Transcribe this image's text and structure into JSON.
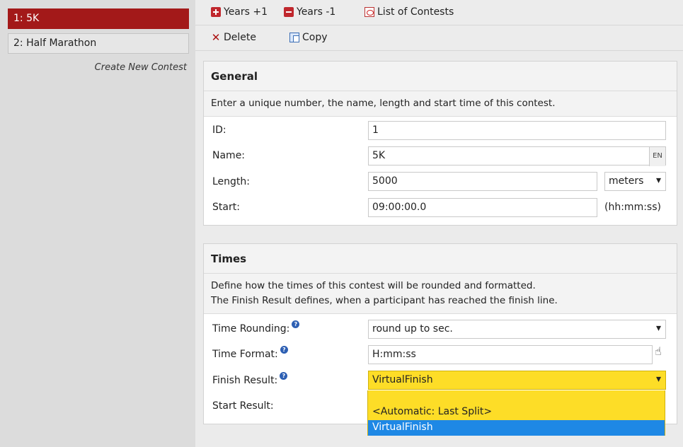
{
  "sidebar": {
    "contests": [
      {
        "label": "1: 5K",
        "active": true
      },
      {
        "label": "2: Half Marathon",
        "active": false
      }
    ],
    "create_label": "Create New Contest"
  },
  "toolbar": {
    "years_plus": "Years +1",
    "years_minus": "Years -1",
    "list_contests": "List of Contests",
    "delete": "Delete",
    "copy": "Copy"
  },
  "general": {
    "title": "General",
    "description": "Enter a unique number, the name, length and start time of this contest.",
    "id_label": "ID:",
    "id_value": "1",
    "name_label": "Name:",
    "name_value": "5K",
    "name_lang": "EN",
    "length_label": "Length:",
    "length_value": "5000",
    "length_unit": "meters",
    "start_label": "Start:",
    "start_value": "09:00:00.0",
    "start_hint": "(hh:mm:ss)"
  },
  "times": {
    "title": "Times",
    "description_line1": "Define how the times of this contest will be rounded and formatted.",
    "description_line2": "The Finish Result defines, when a participant has reached the finish line.",
    "rounding_label": "Time Rounding:",
    "rounding_value": "round up to sec.",
    "format_label": "Time Format:",
    "format_value": "H:mm:ss",
    "finish_label": "Finish Result:",
    "finish_value": "VirtualFinish",
    "start_result_label": "Start Result:",
    "finish_options": [
      "",
      "<Automatic: Last Split>",
      "VirtualFinish"
    ],
    "finish_selected_index": 2
  },
  "colors": {
    "active_contest": "#a31919",
    "highlight_yellow": "#fddd27",
    "selected_option": "#1e88e5"
  }
}
